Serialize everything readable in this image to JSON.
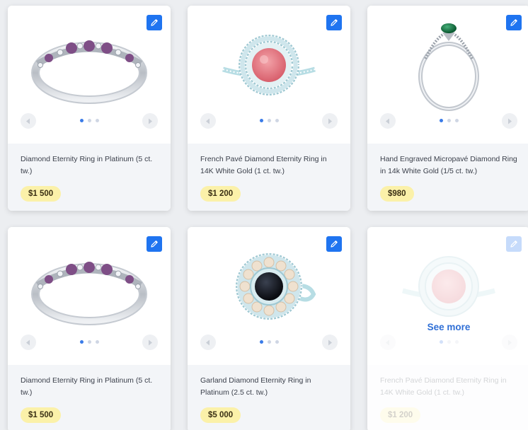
{
  "colors": {
    "accent": "#1f74f0",
    "price_bg": "#fbf1a9",
    "dot_active": "#3a7be8"
  },
  "icons": {
    "edit": "pencil-icon",
    "prev": "triangle-left-icon",
    "next": "triangle-right-icon"
  },
  "products": [
    {
      "title": "Diamond Eternity Ring in Platinum (5 ct. tw.)",
      "price": "$1 500",
      "image": "amethyst-band-ring"
    },
    {
      "title": "French Pavé Diamond Eternity Ring in 14K White Gold (1 ct. tw.)",
      "price": "$1 200",
      "image": "pink-halo-ring"
    },
    {
      "title": "Hand Engraved Micropavé Diamond Ring in 14k White Gold (1/5 ct. tw.)",
      "price": "$980",
      "image": "emerald-solitaire-ring"
    },
    {
      "title": "Diamond Eternity Ring in Platinum (5 ct. tw.)",
      "price": "$1 500",
      "image": "amethyst-band-ring"
    },
    {
      "title": "Garland Diamond Eternity Ring in Platinum (2.5 ct. tw.)",
      "price": "$5 000",
      "image": "black-pearl-ring"
    },
    {
      "title": "French Pavé Diamond Eternity Ring in 14K White Gold (1 ct. tw.)",
      "price": "$1 200",
      "image": "pink-halo-ring"
    }
  ],
  "see_more_label": "See more"
}
